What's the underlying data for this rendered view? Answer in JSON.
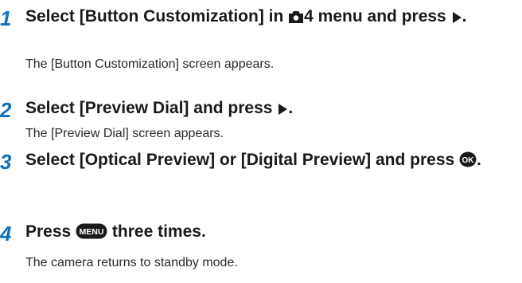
{
  "steps": [
    {
      "number": "1",
      "title_a": "Select [Button Customization] in ",
      "menu_tab": "4",
      "title_b": " menu and press ",
      "title_end": ".",
      "description": "The [Button Customization] screen appears.",
      "icons": [
        "camera-menu-tab-icon",
        "right-arrow-icon"
      ]
    },
    {
      "number": "2",
      "title_a": "Select [Preview Dial] and press ",
      "title_end": ".",
      "description": "The [Preview Dial] screen appears.",
      "icons": [
        "right-arrow-icon"
      ]
    },
    {
      "number": "3",
      "title_a": "Select [Optical Preview] or [Digital Preview] and press ",
      "ok_label": "OK",
      "title_end": ".",
      "icons": [
        "ok-button-icon"
      ]
    },
    {
      "number": "4",
      "title_a": "Press ",
      "menu_label": "MENU",
      "title_b": " three times.",
      "description": "The camera returns to standby mode.",
      "icons": [
        "menu-button-icon"
      ]
    }
  ],
  "colors": {
    "step_number": "#0f6fc0",
    "text": "#1a1a1a"
  }
}
